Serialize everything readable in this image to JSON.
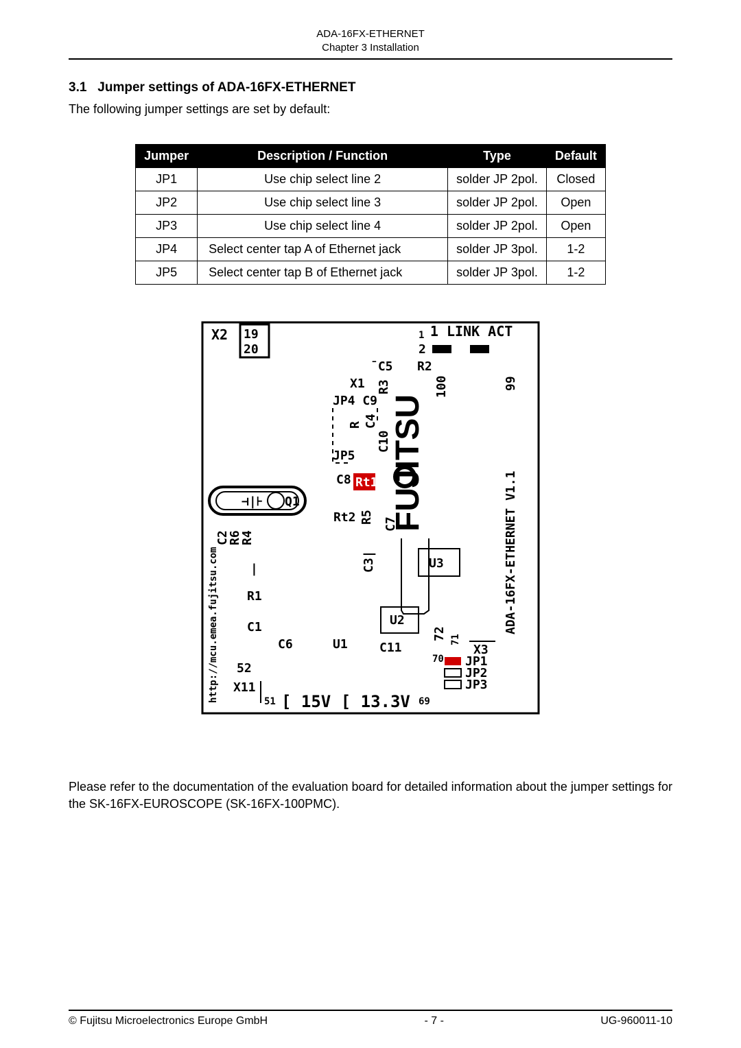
{
  "header": {
    "line1": "ADA-16FX-ETHERNET",
    "line2": "Chapter 3 Installation"
  },
  "section": {
    "number": "3.1",
    "title": "Jumper settings of ADA-16FX-ETHERNET"
  },
  "intro": "The following jumper settings are set by default:",
  "table": {
    "head": {
      "c1": "Jumper",
      "c2": "Description / Function",
      "c3": "Type",
      "c4": "Default"
    },
    "rows": [
      {
        "c1": "JP1",
        "c2": "Use chip select line 2",
        "c3": "solder JP 2pol.",
        "c4": "Closed",
        "center": true
      },
      {
        "c1": "JP2",
        "c2": "Use chip select line 3",
        "c3": "solder JP 2pol.",
        "c4": "Open",
        "center": true
      },
      {
        "c1": "JP3",
        "c2": "Use chip select line 4",
        "c3": "solder JP 2pol.",
        "c4": "Open",
        "center": true
      },
      {
        "c1": "JP4",
        "c2": "Select center tap A of Ethernet jack",
        "c3": "solder JP 3pol.",
        "c4": "1-2",
        "center": false
      },
      {
        "c1": "JP5",
        "c2": "Select center tap B of Ethernet jack",
        "c3": "solder JP 3pol.",
        "c4": "1-2",
        "center": false
      }
    ]
  },
  "diagram": {
    "labels": {
      "x2_top": "X2",
      "x2_pin_top": "19",
      "x2_pin_bot": "20",
      "link": "1 LINK ACT",
      "two": "2",
      "c5": "C5",
      "r2": "R2",
      "x1": "X1",
      "jp4_c9": "JP4 C9",
      "r3": "R3",
      "r_pair": "R",
      "c4": "C4",
      "hundred": "100",
      "ninenine": "99",
      "jp5": "JP5",
      "c10": "C10",
      "c8": "C8",
      "rt1": "Rt1",
      "q1": "Q1",
      "rectleft": "⊣|⊦",
      "rt2": "Rt2",
      "r5": "R5",
      "c7": "C7",
      "c2": "C2",
      "r6": "R6",
      "r4": "R4",
      "vbar": "|",
      "c31": "C3|",
      "u3": "U3",
      "r1": "R1",
      "c1l": "C1",
      "c6": "C6",
      "u1": "U1",
      "u2": "U2",
      "c11": "C11",
      "seventy_two": "72",
      "seventy_one": "71",
      "x3": "X3",
      "seventy": "70",
      "fiftytwo": "52",
      "x11": "X11",
      "fiftyone": "51",
      "a15v": "15V",
      "a13_3v": "13.3V",
      "sixtynine": "69",
      "jp1": "JP1",
      "jp2": "JP2",
      "jp3": "JP3",
      "url": "http://mcu.emea.fujitsu.com",
      "board": "ADA-16FX-ETHERNET V1.1",
      "fujitsu": "FUJITSU"
    }
  },
  "note": "Please refer to the documentation of the evaluation board for detailed information about the jumper settings for the SK-16FX-EUROSCOPE (SK-16FX-100PMC).",
  "footer": {
    "left": "© Fujitsu Microelectronics Europe GmbH",
    "center": "- 7 -",
    "right": "UG-960011-10"
  }
}
